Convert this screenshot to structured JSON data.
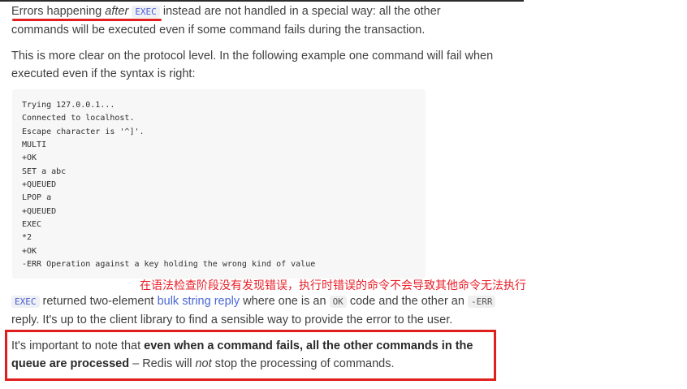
{
  "para1": {
    "text_a": "Errors happening ",
    "text_after": "after",
    "code_exec": "EXEC",
    "text_b": " instead are not handled in a special way: all the other commands will be executed even if some command fails during the transaction."
  },
  "para2": {
    "text": "This is more clear on the protocol level. In the following example one command will fail when executed even if the syntax is right:"
  },
  "code_block": {
    "lines": [
      "Trying 127.0.0.1...",
      "Connected to localhost.",
      "Escape character is '^]'.",
      "MULTI",
      "+OK",
      "SET a abc",
      "+QUEUED",
      "LPOP a",
      "+QUEUED",
      "EXEC",
      "*2",
      "+OK",
      "-ERR Operation against a key holding the wrong kind of value"
    ]
  },
  "annotation": {
    "text": "在语法检查阶段没有发现错误，执行时错误的命令不会导致其他命令无法执行",
    "color": "#e8202a"
  },
  "para3": {
    "code_exec": "EXEC",
    "text_a": " returned two-element ",
    "link": "bulk string reply",
    "text_b": " where one is an ",
    "code_ok": "OK",
    "text_c": " code and the other an ",
    "code_err": "-ERR",
    "text_d": " reply. It's up to the client library to find a sensible way to provide the error to the user."
  },
  "para4": {
    "text_a": "It's important to note that ",
    "bold": "even when a command fails, all the other commands in the queue are processed",
    "text_b": " – Redis will ",
    "italic": "not",
    "text_c": " stop the processing of commands."
  },
  "colors": {
    "highlight_red": "#e01e1e",
    "link_blue": "#4a67d6"
  }
}
